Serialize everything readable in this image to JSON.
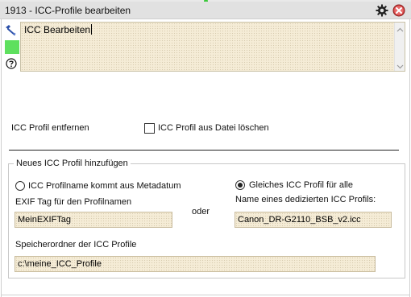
{
  "window": {
    "title": "1913 - ICC-Profile bearbeiten",
    "icons": {
      "settings": "gear-icon",
      "close": "close-icon",
      "tool": "tool-icon",
      "help": "help-icon"
    },
    "colors": {
      "titlebar": "#e1e1e1",
      "status_green": "#5ee05e",
      "field_bg": "#f5ecd6"
    }
  },
  "editor": {
    "text": "ICC Bearbeiten"
  },
  "remove_section": {
    "label": "ICC Profil entfernen",
    "checkbox_label": "ICC Profil aus Datei löschen",
    "checkbox_checked": false
  },
  "add_group": {
    "title": "Neues ICC Profil hinzufügen",
    "radio_metadata": "ICC Profilname kommt aus Metadatum",
    "radio_same": "Gleiches ICC Profil für alle",
    "selected": "same",
    "exif_label": "EXIF Tag für den Profilnamen",
    "exif_value": "MeinEXIFTag",
    "or_label": "oder",
    "dedicated_label": "Name eines dedizierten ICC Profils:",
    "dedicated_value": "Canon_DR-G2110_BSB_v2.icc",
    "folder_label": "Speicherordner der ICC Profile",
    "folder_value": "c:\\meine_ICC_Profile"
  }
}
